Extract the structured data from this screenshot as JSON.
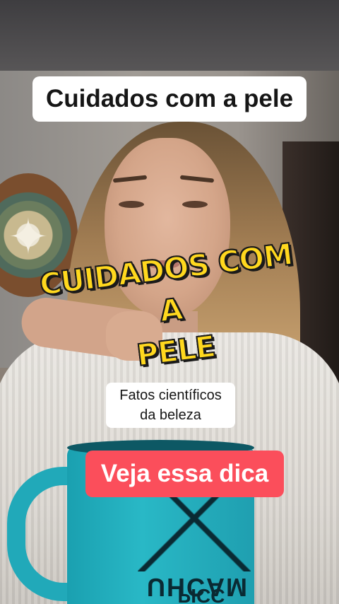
{
  "video": {
    "top_caption": "Cuidados com a pele",
    "sticker_title": [
      "CUIDADOS COM A",
      "PELE"
    ],
    "fact_caption": [
      "Fatos científicos",
      "da beleza"
    ],
    "cta_label": "Veja essa dica",
    "mug_print": [
      "UHCAM",
      "PICC"
    ]
  },
  "colors": {
    "sticker_fill": "#ffd81e",
    "cta_background": "#fb4e5b",
    "mug_teal": "#29b8c6"
  }
}
